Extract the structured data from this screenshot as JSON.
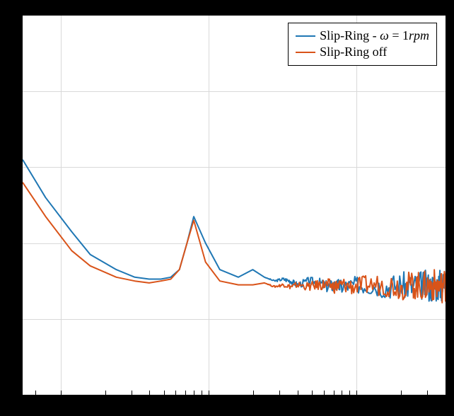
{
  "chart_data": {
    "type": "line",
    "title": "",
    "xlabel": "",
    "ylabel": "",
    "x_scale": "log",
    "xlim": [
      0.7,
      500
    ],
    "ylim": [
      0,
      1
    ],
    "legend_position": "upper right",
    "grid": true,
    "series": [
      {
        "name": "Slip-Ring - ω = 1rpm",
        "color": "#1f77b4",
        "x": [
          0.7,
          1,
          1.5,
          2,
          3,
          4,
          5,
          6,
          7,
          8,
          9,
          10,
          12,
          15,
          20,
          25,
          30,
          35,
          40,
          45,
          50,
          60,
          70,
          80,
          90,
          100,
          120,
          150,
          200,
          250,
          300,
          350,
          400,
          450,
          500
        ],
        "y": [
          0.62,
          0.52,
          0.43,
          0.37,
          0.33,
          0.31,
          0.305,
          0.305,
          0.31,
          0.33,
          0.4,
          0.47,
          0.4,
          0.33,
          0.31,
          0.33,
          0.31,
          0.3,
          0.305,
          0.3,
          0.29,
          0.3,
          0.295,
          0.285,
          0.29,
          0.285,
          0.29,
          0.29,
          0.285,
          0.29,
          0.285,
          0.29,
          0.285,
          0.29,
          0.285
        ]
      },
      {
        "name": "Slip-Ring off",
        "color": "#d95319",
        "x": [
          0.7,
          1,
          1.5,
          2,
          3,
          4,
          5,
          6,
          7,
          8,
          9,
          10,
          12,
          15,
          20,
          25,
          30,
          35,
          40,
          45,
          50,
          60,
          70,
          80,
          90,
          100,
          120,
          150,
          200,
          250,
          300,
          350,
          400,
          450,
          500
        ],
        "y": [
          0.56,
          0.47,
          0.38,
          0.34,
          0.31,
          0.3,
          0.295,
          0.3,
          0.305,
          0.33,
          0.4,
          0.46,
          0.35,
          0.3,
          0.29,
          0.29,
          0.295,
          0.285,
          0.29,
          0.285,
          0.29,
          0.285,
          0.29,
          0.29,
          0.285,
          0.29,
          0.285,
          0.29,
          0.29,
          0.285,
          0.29,
          0.285,
          0.29,
          0.285,
          0.29
        ]
      }
    ],
    "noise_amplitude_start_x": 30,
    "noise_amplitude": 0.045,
    "legend": {
      "items": [
        "Slip-Ring - ω = 1rpm",
        "Slip-Ring off"
      ]
    }
  }
}
